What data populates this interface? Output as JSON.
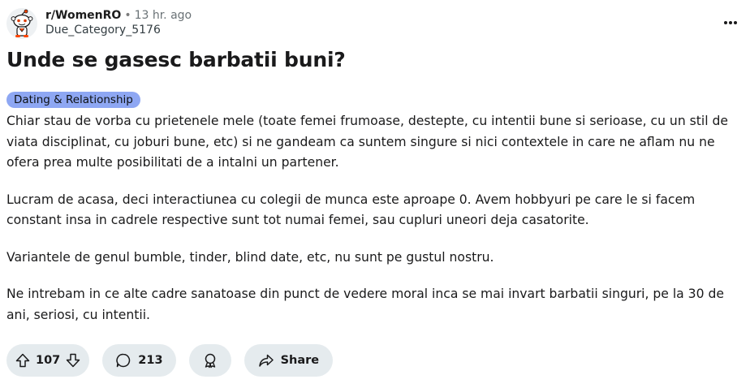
{
  "post": {
    "subreddit": "r/WomenRO",
    "separator": "•",
    "time_ago": "13 hr. ago",
    "author": "Due_Category_5176",
    "title": "Unde se gasesc barbatii buni?",
    "flair": "Dating & Relationship",
    "paragraphs": [
      "Chiar stau de vorba cu prietenele mele (toate femei frumoase, destepte, cu intentii bune si serioase, cu un stil de viata disciplinat, cu joburi bune, etc) si ne gandeam ca suntem singure si nici contextele in care ne aflam nu ne ofera prea multe posibilitati de a intalni un partener.",
      "Lucram de acasa, deci interactiunea cu colegii de munca este aproape 0. Avem hobbyuri pe care le si facem constant insa in cadrele respective sunt tot numai femei, sau cupluri uneori deja casatorite.",
      "Variantele de genul bumble, tinder, blind date, etc, nu sunt pe gustul nostru.",
      "Ne intrebam in ce alte cadre sanatoase din punct de vedere moral inca se mai invart barbatii singuri, pe la 30 de ani, seriosi, cu intentii."
    ]
  },
  "actions": {
    "votes": "107",
    "comments": "213",
    "share_label": "Share"
  },
  "icons": {
    "avatar": "snoo-avatar-icon",
    "more": "more-horizontal-icon",
    "upvote": "upvote-arrow-icon",
    "downvote": "downvote-arrow-icon",
    "comment": "comment-bubble-icon",
    "award": "award-icon",
    "share": "share-arrow-icon"
  },
  "colors": {
    "flair_bg": "#8ea7f3",
    "pill_bg": "#e5ebee",
    "text": "#1a1a1b",
    "meta_gray": "#6a7276"
  }
}
